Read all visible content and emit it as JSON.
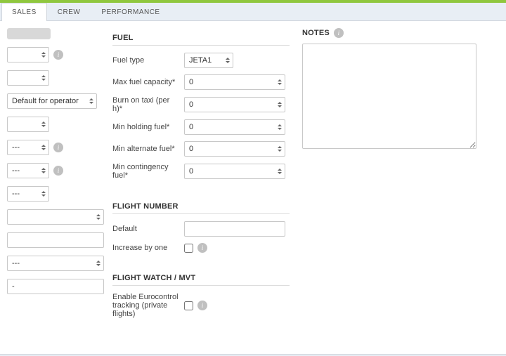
{
  "tabs": {
    "sales": "SALES",
    "crew": "CREW",
    "performance": "PERFORMANCE"
  },
  "left": {
    "sel1_value": "",
    "sel2_value": "",
    "sel_default_op": "Default for operator",
    "sel3_value": "",
    "sel_dash1": "---",
    "sel_dash2": "---",
    "sel_dash3": "---",
    "sel4_value": "",
    "txt1_value": "",
    "sel_dash4": "---",
    "txt_dash": "-"
  },
  "fuel": {
    "title": "FUEL",
    "type_label": "Fuel type",
    "type_value": "JETA1",
    "max_label": "Max fuel capacity*",
    "max_value": "0",
    "burn_label": "Burn on taxi (per h)*",
    "burn_value": "0",
    "hold_label": "Min holding fuel*",
    "hold_value": "0",
    "alt_label": "Min alternate fuel*",
    "alt_value": "0",
    "cont_label": "Min contingency fuel*",
    "cont_value": "0"
  },
  "flight_number": {
    "title": "FLIGHT NUMBER",
    "default_label": "Default",
    "default_value": "",
    "increase_label": "Increase by one",
    "increase_checked": false
  },
  "flight_watch": {
    "title": "FLIGHT WATCH / MVT",
    "euro_label": "Enable Eurocontrol tracking (private flights)",
    "euro_checked": false
  },
  "notes": {
    "title": "NOTES",
    "value": ""
  }
}
